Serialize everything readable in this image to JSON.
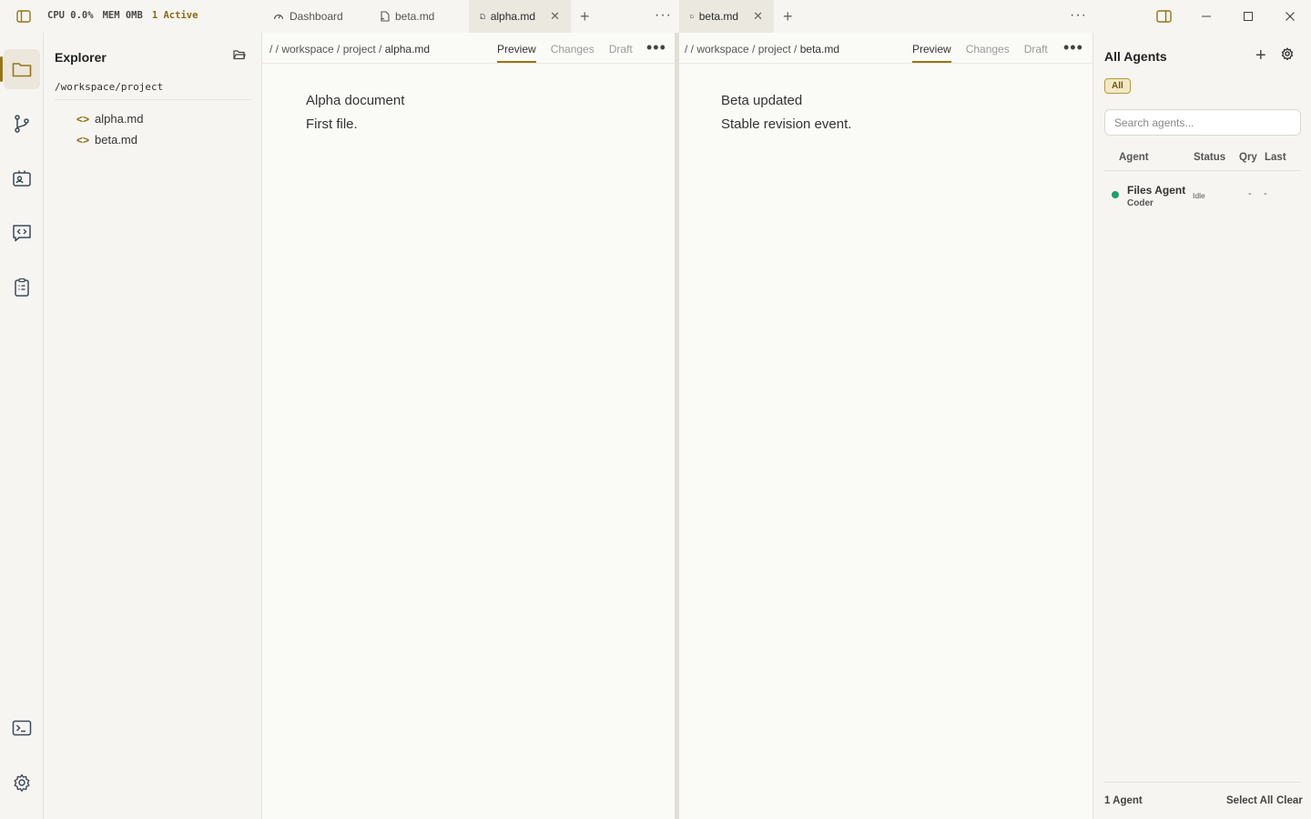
{
  "topbar": {
    "cpu": "CPU 0.0%",
    "mem": "MEM 0MB",
    "active": "1 Active"
  },
  "left_group": {
    "tabs": [
      {
        "label": "Dashboard",
        "icon": "dashboard-icon"
      },
      {
        "label": "beta.md",
        "icon": "file-icon"
      },
      {
        "label": "alpha.md",
        "icon": "file-icon",
        "active": true
      }
    ]
  },
  "right_group": {
    "tabs": [
      {
        "label": "beta.md",
        "icon": "file-icon",
        "active": true
      }
    ]
  },
  "explorer": {
    "title": "Explorer",
    "root": "/workspace/project",
    "files": [
      "alpha.md",
      "beta.md"
    ]
  },
  "editor_left": {
    "crumbs": "/ / workspace / project /",
    "file": "alpha.md",
    "modes": [
      "Preview",
      "Changes",
      "Draft"
    ],
    "lines": [
      "Alpha document",
      "First file."
    ]
  },
  "editor_right": {
    "crumbs": "/ / workspace / project /",
    "file": "beta.md",
    "modes": [
      "Preview",
      "Changes",
      "Draft"
    ],
    "lines": [
      "Beta updated",
      "Stable revision event."
    ]
  },
  "agents": {
    "title": "All Agents",
    "filter": "All",
    "search_placeholder": "Search agents...",
    "columns": {
      "agent": "Agent",
      "status": "Status",
      "qry": "Qry",
      "last": "Last"
    },
    "rows": [
      {
        "name": "Files Agent",
        "role": "Coder",
        "status": "Idle",
        "qry": "-",
        "last": "-",
        "status_color": "#1e9e6a"
      }
    ],
    "count": "1 Agent",
    "select_all": "Select All",
    "clear": "Clear"
  },
  "colors": {
    "accent": "#9a7412",
    "idle": "#1e9e6a"
  }
}
